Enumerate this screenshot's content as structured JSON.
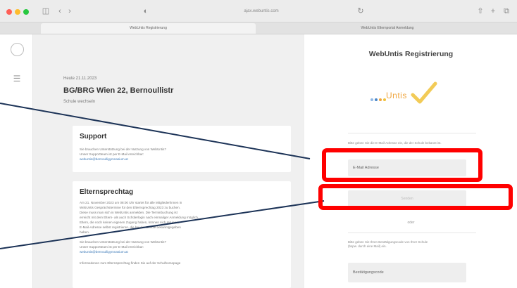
{
  "browser": {
    "address": "ajax.webuntis.com",
    "tabs": [
      "WebUntis Registrierung",
      "WebUntis Elternportal Anmeldung"
    ],
    "nav_icons": [
      "sidebar-icon",
      "back-icon",
      "forward-icon",
      "shield-icon",
      "reload-icon",
      "share-icon",
      "new-tab-icon",
      "tab-overview-icon"
    ],
    "glyphs": {
      "sidebar": "◫",
      "back": "‹",
      "forward": "›",
      "shield": "◐",
      "reload": "↻",
      "share": "⇧",
      "new_tab": "+",
      "tabs": "⧉"
    }
  },
  "rail": {
    "calendar_glyph": "☰"
  },
  "school": {
    "date": "Heute 21.11.2023",
    "name": "BG/BRG Wien 22, Bernoullistr",
    "switch_label": "Schule wechseln"
  },
  "support": {
    "title": "Support",
    "lines": [
      "Sie brauchen Unterstützung bei der Nutzung von WebUntis?",
      "Unser Supportteam ist per E-Mail erreichbar:"
    ],
    "email": "webuntis@bernoulligymnasium.at"
  },
  "elternsprechtag": {
    "title": "Elternsprechtag",
    "lines": [
      "Am 21. November 2023 um 08:00 Uhr startet für alle Mitglieder/innen in",
      "WebUntis Gesprächstermine für den Elternsprechtag 2023 zu buchen.",
      "Diese muss man sich in WebUntis anmelden. Die Terminbuchung ist",
      "erreicht mit dem Eltern- als auch Schülerlogin nach einmaliger Anmeldung möglich.",
      "Eltern, die noch keinen eigenen Zugang haben, können sich mit jener",
      "E-Mail-Adresse selbst registrieren, die bei der Schule bekanntgegeben",
      "haben."
    ],
    "support_lines": [
      "Sie brauchen Unterstützung bei der Nutzung von WebUntis?",
      "Unser Supportteam ist per E-Mail erreichbar:"
    ],
    "email": "webuntis@bernoulligymnasium.at",
    "more": "Informationen zum Elternsprechtag finden Sie auf der Schulhomepage"
  },
  "registration": {
    "title": "WebUntis Registrierung",
    "logo_text": "Untis",
    "logo_colors": [
      "#8fb8e6",
      "#4a86c8",
      "#f0a640",
      "#f0c23a"
    ],
    "email_hint": "Bitte geben Sie die E-Mail-Adresse ein, die der Schule bekannt ist.",
    "email_placeholder": "E-Mail Adresse",
    "submit_label": "Senden",
    "or_label": "oder",
    "code_hint_lines": [
      "Bitte geben Sie Ihren Bestätigungscode von Ihrer Schule",
      "(bspw. durch eine Mail) ein."
    ],
    "code_placeholder": "Bestätigungscode"
  },
  "annotation": {
    "color": "#ff0000",
    "line_color": "#1c3357"
  }
}
